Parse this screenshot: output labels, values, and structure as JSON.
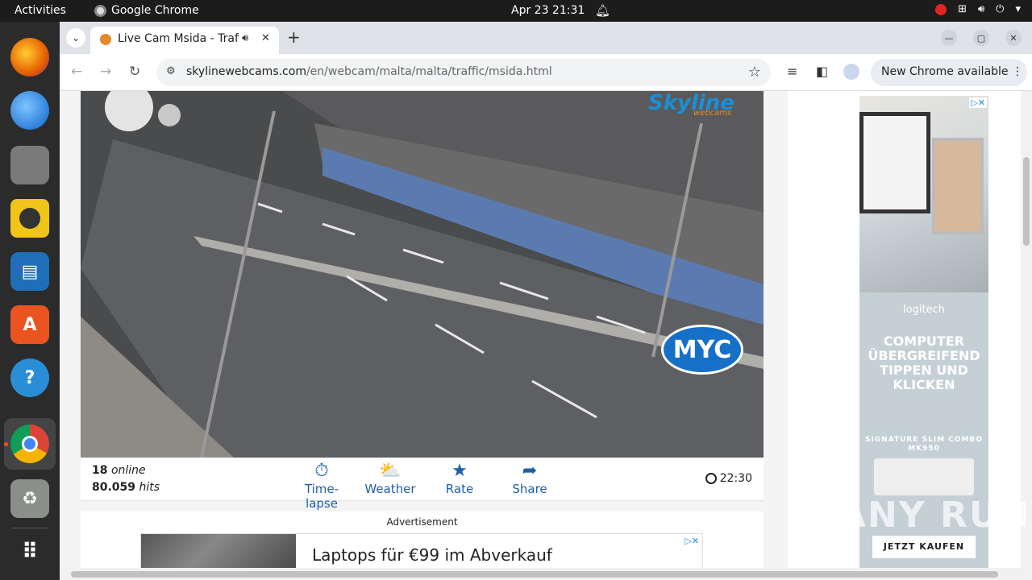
{
  "topbar": {
    "activities": "Activities",
    "app_name": "Google Chrome",
    "datetime": "Apr 23  21:31"
  },
  "dock": {
    "items": [
      "firefox-icon",
      "thunderbird-icon",
      "files-icon",
      "rhythmbox-icon",
      "libreoffice-writer-icon",
      "app-center-icon",
      "help-icon",
      "chrome-icon",
      "trash-icon",
      "show-apps-icon"
    ]
  },
  "browser": {
    "tab_title": "Live Cam Msida - Traffic",
    "url_host": "skylinewebcams.com",
    "url_path": "/en/webcam/malta/malta/traffic/msida.html",
    "update_label": "New Chrome available"
  },
  "video": {
    "logo": "Skyline",
    "logo_sub": "webcams",
    "overlay_logo": "MYC"
  },
  "infobar": {
    "online_count": "18",
    "online_label": "online",
    "hits_count": "80.059",
    "hits_label": "hits",
    "actions": [
      {
        "label": "Time-lapse",
        "icon": "timelapse-icon"
      },
      {
        "label": "Weather",
        "icon": "weather-icon"
      },
      {
        "label": "Rate",
        "icon": "star-icon"
      },
      {
        "label": "Share",
        "icon": "share-icon"
      }
    ],
    "time": "22:30"
  },
  "ad": {
    "label": "Advertisement",
    "banner_text": "Laptops für €99 im Abverkauf"
  },
  "side_ad": {
    "brand": "logitech",
    "headline": "COMPUTER ÜBERGREIFEND TIPPEN UND KLICKEN",
    "product": "SIGNATURE SLIM COMBO MK950",
    "cta": "JETZT KAUFEN"
  },
  "watermark": "ANY RUN"
}
